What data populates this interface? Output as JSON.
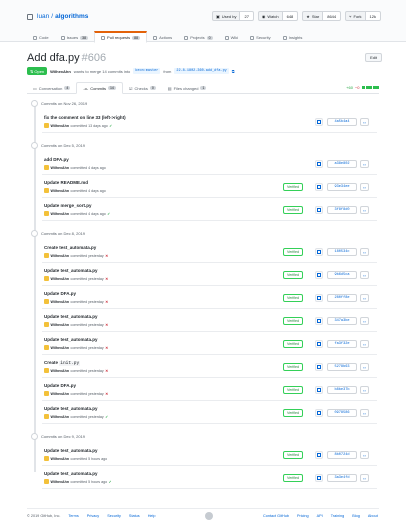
{
  "repo": {
    "owner": "luan",
    "separator": "/",
    "name": "algorithms"
  },
  "actions": [
    {
      "label": "Used by",
      "count": "27",
      "icon": "package-icon"
    },
    {
      "label": "Watch",
      "count": "648",
      "icon": "eye-icon"
    },
    {
      "label": "Star",
      "count": "8644",
      "icon": "star-icon"
    },
    {
      "label": "Fork",
      "count": "12k",
      "icon": "fork-icon"
    }
  ],
  "repo_tabs": [
    {
      "label": "Code",
      "count": "",
      "icon": "code-icon"
    },
    {
      "label": "Issues",
      "count": "38",
      "icon": "issue-icon"
    },
    {
      "label": "Pull requests",
      "count": "88",
      "icon": "pr-icon",
      "active": true
    },
    {
      "label": "Actions",
      "count": "",
      "icon": "play-icon"
    },
    {
      "label": "Projects",
      "count": "0",
      "icon": "project-icon"
    },
    {
      "label": "Wiki",
      "count": "",
      "icon": "book-icon"
    },
    {
      "label": "Security",
      "count": "",
      "icon": "shield-icon"
    },
    {
      "label": "Insights",
      "count": "",
      "icon": "graph-icon"
    }
  ],
  "pr": {
    "title": "Add dfa.py",
    "number": "#606",
    "edit_label": "Edit",
    "state": "Open",
    "author": "WilhexAhn",
    "meta_text": "wants to merge 14 commits into",
    "base": "keon:master",
    "from_text": "from",
    "head": "22-8-1802-360-add_dfa.py"
  },
  "pr_tabs": [
    {
      "label": "Conversation",
      "count": "4"
    },
    {
      "label": "Commits",
      "count": "14",
      "active": true
    },
    {
      "label": "Checks",
      "count": "0"
    },
    {
      "label": "Files changed",
      "count": "1"
    }
  ],
  "diffstat": {
    "add": "+60",
    "del": "−0"
  },
  "groups": [
    {
      "label": "Commits on Nov 26, 2019",
      "commits": [
        {
          "msg": "fix the comment on line 33 (left->right)",
          "author": "WilhexAhn",
          "when": "committed 13 days ago",
          "status": "ok",
          "verified": "",
          "sha": "4a5b4a4"
        }
      ]
    },
    {
      "label": "Commits on Dec 5, 2019",
      "commits": [
        {
          "msg": "add DFA.py",
          "author": "WilhexAhn",
          "when": "committed 4 days ago",
          "status": "",
          "verified": "",
          "sha": "a38e802"
        },
        {
          "msg": "Update README.md",
          "author": "WilhexAhn",
          "when": "committed 4 days ago",
          "status": "",
          "verified": "Verified",
          "sha": "93e34ee"
        },
        {
          "msg": "Update merge_sort.py",
          "author": "WilhexAhn",
          "when": "committed 4 days ago",
          "status": "ok",
          "verified": "Verified",
          "sha": "3f8f8d0"
        }
      ]
    },
    {
      "label": "Commits on Dec 8, 2019",
      "commits": [
        {
          "msg": "Create test_automata.py",
          "author": "WilhexAhn",
          "when": "committed yesterday",
          "status": "fail",
          "verified": "Verified",
          "sha": "180534c"
        },
        {
          "msg": "Update test_automata.py",
          "author": "WilhexAhn",
          "when": "committed yesterday",
          "status": "fail",
          "verified": "Verified",
          "sha": "9b6d5ca"
        },
        {
          "msg": "Update DFA.py",
          "author": "WilhexAhn",
          "when": "committed yesterday",
          "status": "fail",
          "verified": "Verified",
          "sha": "280ff8e"
        },
        {
          "msg": "Update test_automata.py",
          "author": "WilhexAhn",
          "when": "committed yesterday",
          "status": "fail",
          "verified": "Verified",
          "sha": "347a3be"
        },
        {
          "msg": "Update test_automata.py",
          "author": "WilhexAhn",
          "when": "committed yesterday",
          "status": "fail",
          "verified": "Verified",
          "sha": "fa3f32e"
        },
        {
          "msg": "Create",
          "code": "init.py",
          "author": "WilhexAhn",
          "when": "committed yesterday",
          "status": "fail",
          "verified": "Verified",
          "sha": "5278b63"
        },
        {
          "msg": "Update DFA.py",
          "author": "WilhexAhn",
          "when": "committed yesterday",
          "status": "fail",
          "verified": "Verified",
          "sha": "b8be37b"
        },
        {
          "msg": "Update test_automata.py",
          "author": "WilhexAhn",
          "when": "committed yesterday",
          "status": "ok",
          "verified": "Verified",
          "sha": "0978586"
        }
      ]
    },
    {
      "label": "Commits on Dec 9, 2019",
      "commits": [
        {
          "msg": "Update test_automata.py",
          "author": "WilhexAhn",
          "when": "committed 5 hours ago",
          "status": "",
          "verified": "Verified",
          "sha": "8b0724d"
        },
        {
          "msg": "Update test_automata.py",
          "author": "WilhexAhn",
          "when": "committed 5 hours ago",
          "status": "ok",
          "verified": "Verified",
          "sha": "3a3e4fd"
        }
      ]
    }
  ],
  "footer": {
    "left": [
      "© 2019 GitHub, Inc.",
      "Terms",
      "Privacy",
      "Security",
      "Status",
      "Help"
    ],
    "right": [
      "Contact GitHub",
      "Pricing",
      "API",
      "Training",
      "Blog",
      "About"
    ]
  }
}
